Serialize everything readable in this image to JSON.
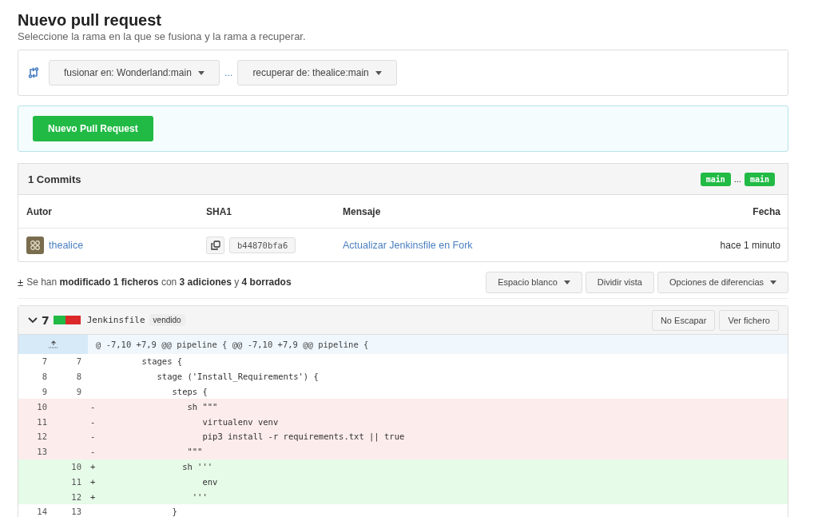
{
  "page": {
    "title": "Nuevo pull request",
    "subtitle": "Seleccione la rama en la que se fusiona y la rama a recuperar."
  },
  "branches": {
    "target": "fusionar en: Wonderland:main",
    "separator": "...",
    "source": "recuperar de: thealice:main"
  },
  "create_button": "Nuevo Pull Request",
  "commits": {
    "title": "1 Commits",
    "base_tag": "main",
    "separator": "...",
    "head_tag": "main",
    "columns": [
      "Autor",
      "SHA1",
      "Mensaje",
      "Fecha"
    ],
    "rows": [
      {
        "author": "thealice",
        "sha": "b44870bfa6",
        "message": "Actualizar Jenkinsfile en Fork",
        "date": "hace 1 minuto"
      }
    ]
  },
  "summary": {
    "icon": "±",
    "text": "Se han **modificado 1 ficheros** con **3 adiciones** y **4 borrados**"
  },
  "diff_buttons": [
    {
      "label": "Espacio blanco",
      "dropdown": true
    },
    {
      "label": "Dividir vista",
      "dropdown": false
    },
    {
      "label": "Opciones de diferencias",
      "dropdown": true
    }
  ],
  "file": {
    "expanded": true,
    "changes": "7",
    "diff_bar": {
      "level": 0.45
    },
    "name": "Jenkinsfile",
    "tag": "vendido",
    "buttons": [
      "No Escapar",
      "Ver fichero"
    ],
    "hunk": "@ -7,10 +7,9 @@ pipeline { @@ -7,10 +7,9 @@ pipeline {",
    "lines": [
      {
        "kind": "context",
        "old": "7",
        "new": "7",
        "code": "        stages {"
      },
      {
        "kind": "context",
        "old": "8",
        "new": "8",
        "code": "           stage ('Install_Requirements') {"
      },
      {
        "kind": "context",
        "old": "9",
        "new": "9",
        "code": "              steps {"
      },
      {
        "kind": "del",
        "old": "10",
        "sign": "-",
        "code": "                 sh \"\"\""
      },
      {
        "kind": "del",
        "old": "11",
        "sign": "-",
        "code": "                    virtualenv venv"
      },
      {
        "kind": "del",
        "old": "12",
        "sign": "-",
        "code": "                    pip3 install -r requirements.txt || true"
      },
      {
        "kind": "del",
        "old": "13",
        "sign": "-",
        "code": "                 \"\"\""
      },
      {
        "kind": "add",
        "new": "10",
        "sign": "+",
        "code": "                sh '''"
      },
      {
        "kind": "add",
        "new": "11",
        "sign": "+",
        "code": "                    env"
      },
      {
        "kind": "add",
        "new": "12",
        "sign": "+",
        "code": "                  '''"
      },
      {
        "kind": "context",
        "old": "14",
        "new": "13",
        "code": "              }"
      }
    ]
  }
}
